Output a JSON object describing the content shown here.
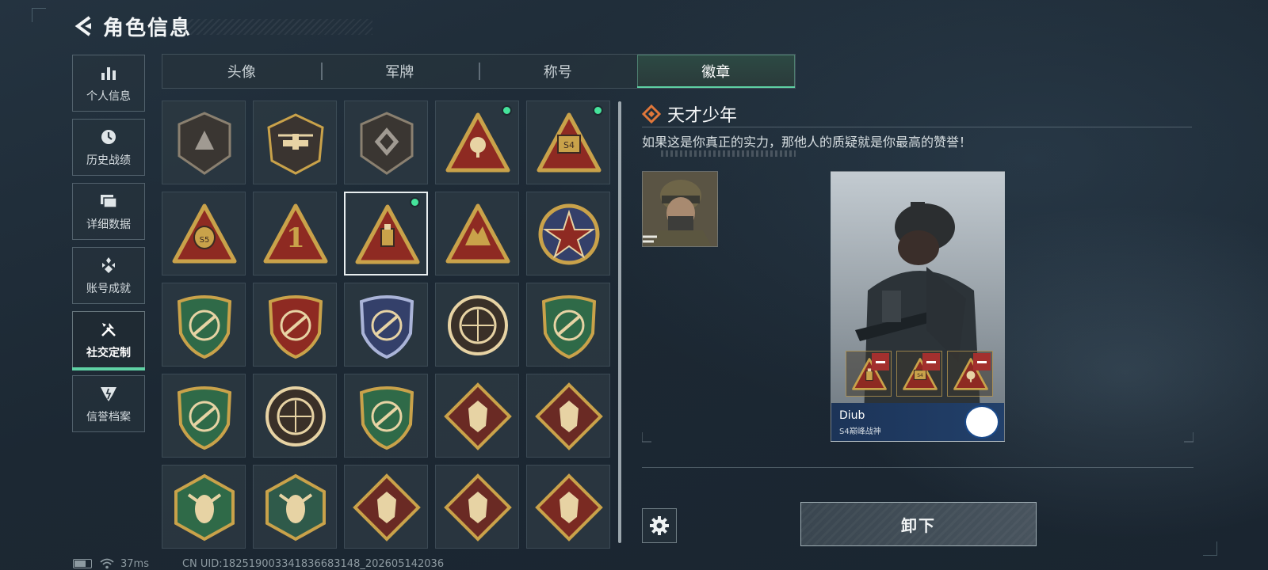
{
  "header": {
    "title": "角色信息"
  },
  "sidebar": {
    "items": [
      {
        "label": "个人信息",
        "icon": "bar-chart-icon",
        "active": false
      },
      {
        "label": "历史战绩",
        "icon": "clock-icon",
        "active": false
      },
      {
        "label": "详细数据",
        "icon": "folders-icon",
        "active": false
      },
      {
        "label": "账号成就",
        "icon": "achievement-icon",
        "active": false
      },
      {
        "label": "社交定制",
        "icon": "tools-icon",
        "active": true
      },
      {
        "label": "信誉档案",
        "icon": "reputation-icon",
        "active": false
      }
    ]
  },
  "tabs": [
    {
      "label": "头像",
      "active": false
    },
    {
      "label": "军牌",
      "active": false
    },
    {
      "label": "称号",
      "active": false
    },
    {
      "label": "徽章",
      "active": true
    }
  ],
  "badges": [
    {
      "icon": "triangle-emblem-badge-icon",
      "new": false,
      "selected": false
    },
    {
      "icon": "helicopter-badge-icon",
      "new": false,
      "selected": false
    },
    {
      "icon": "shield-emblem-badge-icon",
      "new": false,
      "selected": false
    },
    {
      "icon": "radar-dish-badge-icon",
      "new": true,
      "selected": false
    },
    {
      "icon": "s4-crown-badge-icon",
      "new": true,
      "selected": false
    },
    {
      "icon": "s5-bag-badge-icon",
      "new": false,
      "selected": false
    },
    {
      "icon": "number-one-badge-icon",
      "new": false,
      "selected": false
    },
    {
      "icon": "usb-drive-badge-icon",
      "new": true,
      "selected": true
    },
    {
      "icon": "soldiers-badge-icon",
      "new": false,
      "selected": false
    },
    {
      "icon": "star-medal-badge-icon",
      "new": false,
      "selected": false
    },
    {
      "icon": "green-crest-badge-icon",
      "new": false,
      "selected": false
    },
    {
      "icon": "red-crest-badge-icon",
      "new": false,
      "selected": false
    },
    {
      "icon": "diamond-crest-badge-icon",
      "new": false,
      "selected": false
    },
    {
      "icon": "crosshair-skull-badge-icon",
      "new": false,
      "selected": false
    },
    {
      "icon": "green-rifle-badge-icon",
      "new": false,
      "selected": false
    },
    {
      "icon": "green-rifle-wing-badge-icon",
      "new": false,
      "selected": false
    },
    {
      "icon": "scope-rifle-badge-icon",
      "new": false,
      "selected": false
    },
    {
      "icon": "gold-knife-badge-icon",
      "new": false,
      "selected": false
    },
    {
      "icon": "wolf-badge-icon",
      "new": false,
      "selected": false
    },
    {
      "icon": "wolf-badge-2-icon",
      "new": false,
      "selected": false
    },
    {
      "icon": "wasp-badge-icon",
      "new": false,
      "selected": false
    },
    {
      "icon": "medic-arm-badge-icon",
      "new": false,
      "selected": false
    },
    {
      "icon": "dragon-badge-icon",
      "new": false,
      "selected": false
    },
    {
      "icon": "dragon-badge-2-icon",
      "new": false,
      "selected": false
    },
    {
      "icon": "runner-badge-icon",
      "new": false,
      "selected": false
    }
  ],
  "detail": {
    "name": "天才少年",
    "description": "如果这是你真正的实力，那他人的质疑就是你最高的赞誉！",
    "card": {
      "player_name": "Diub",
      "player_title": "S4巅峰战神"
    },
    "unequip_label": "卸下"
  },
  "status": {
    "ping": "37ms",
    "uid": "CN UID:18251900334183668​3148_202605142036"
  },
  "colors": {
    "accent": "#5fd1a4",
    "new_dot": "#45e39b",
    "remove": "#a3302e",
    "gold": "#c9a24a"
  }
}
